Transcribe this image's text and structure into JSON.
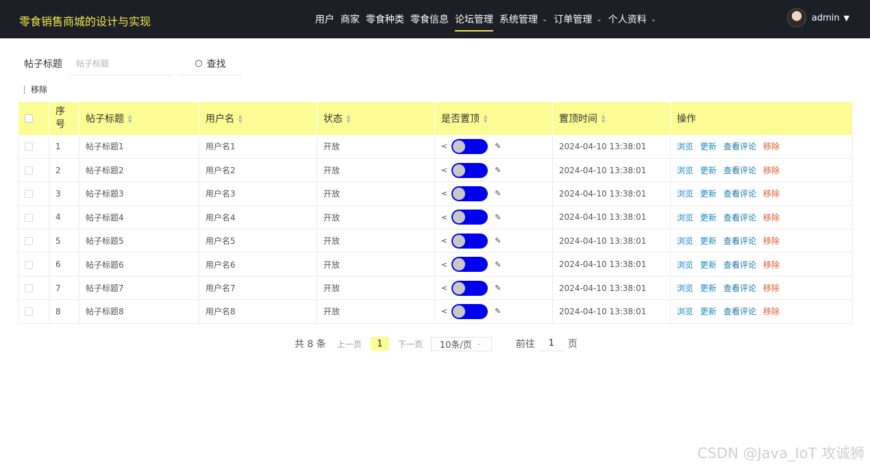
{
  "header": {
    "app_title": "零食销售商城的设计与实现",
    "nav": [
      {
        "label": "用户",
        "has_dropdown": false,
        "active": false
      },
      {
        "label": "商家",
        "has_dropdown": false,
        "active": false
      },
      {
        "label": "零食种类",
        "has_dropdown": false,
        "active": false
      },
      {
        "label": "零食信息",
        "has_dropdown": false,
        "active": false
      },
      {
        "label": "论坛管理",
        "has_dropdown": false,
        "active": true
      },
      {
        "label": "系统管理",
        "has_dropdown": true,
        "active": false
      },
      {
        "label": "订单管理",
        "has_dropdown": true,
        "active": false
      },
      {
        "label": "个人资料",
        "has_dropdown": true,
        "active": false
      }
    ],
    "username": "admin"
  },
  "search": {
    "label": "帖子标题",
    "placeholder": "帖子标题",
    "button_label": "查找"
  },
  "toolbar": {
    "remove_label": "移除"
  },
  "table": {
    "columns": {
      "index": "序号",
      "title": "帖子标题",
      "user": "用户名",
      "status": "状态",
      "pinned": "是否置顶",
      "pin_time": "置顶时间",
      "actions": "操作"
    },
    "action_labels": {
      "view": "浏览",
      "update": "更新",
      "comments": "查看评论",
      "remove": "移除"
    },
    "rows": [
      {
        "index": "1",
        "title": "帖子标题1",
        "user": "用户名1",
        "status": "开放",
        "pinned": false,
        "pin_time": "2024-04-10 13:38:01"
      },
      {
        "index": "2",
        "title": "帖子标题2",
        "user": "用户名2",
        "status": "开放",
        "pinned": false,
        "pin_time": "2024-04-10 13:38:01"
      },
      {
        "index": "3",
        "title": "帖子标题3",
        "user": "用户名3",
        "status": "开放",
        "pinned": false,
        "pin_time": "2024-04-10 13:38:01"
      },
      {
        "index": "4",
        "title": "帖子标题4",
        "user": "用户名4",
        "status": "开放",
        "pinned": false,
        "pin_time": "2024-04-10 13:38:01"
      },
      {
        "index": "5",
        "title": "帖子标题5",
        "user": "用户名5",
        "status": "开放",
        "pinned": false,
        "pin_time": "2024-04-10 13:38:01"
      },
      {
        "index": "6",
        "title": "帖子标题6",
        "user": "用户名6",
        "status": "开放",
        "pinned": false,
        "pin_time": "2024-04-10 13:38:01"
      },
      {
        "index": "7",
        "title": "帖子标题7",
        "user": "用户名7",
        "status": "开放",
        "pinned": false,
        "pin_time": "2024-04-10 13:38:01"
      },
      {
        "index": "8",
        "title": "帖子标题8",
        "user": "用户名8",
        "status": "开放",
        "pinned": false,
        "pin_time": "2024-04-10 13:38:01"
      }
    ]
  },
  "pagination": {
    "total": "共 8 条",
    "prev": "上一页",
    "current": "1",
    "next": "下一页",
    "page_size": "10条/页",
    "goto_prefix": "前往",
    "goto_value": "1",
    "goto_suffix": "页"
  },
  "watermark": "CSDN @Java_IoT 攻诚狮",
  "colors": {
    "header_bg": "#1c1f26",
    "accent_yellow": "#fbfc94",
    "title_yellow": "#f5e94a",
    "switch_blue": "#0000ee",
    "link_blue": "#1e88c8",
    "delete_orange": "#e2582e"
  }
}
